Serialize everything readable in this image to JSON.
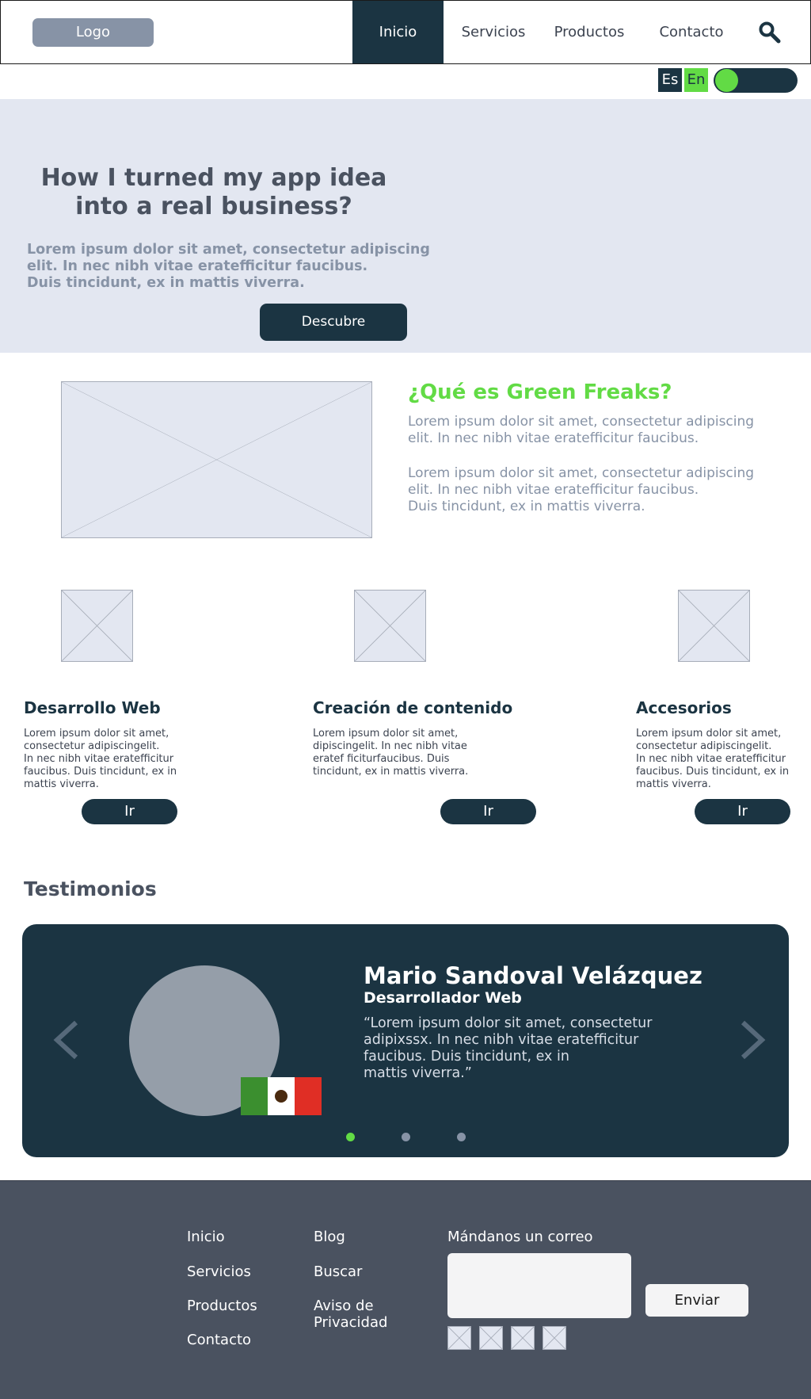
{
  "header": {
    "logo": "Logo",
    "nav": [
      "Inicio",
      "Servicios",
      "Productos",
      "Contacto"
    ],
    "active": "Inicio",
    "search_icon": "search-icon"
  },
  "language": {
    "es": "Es",
    "en": "En",
    "toggle_state": "on"
  },
  "hero": {
    "title": "How I turned my app idea into a real business?",
    "text_lines": [
      "Lorem ipsum dolor sit amet, consectetur adipiscing",
      "elit. In nec nibh vitae eratefficitur faucibus.",
      "Duis tincidunt, ex in mattis viverra."
    ],
    "button": "Descubre"
  },
  "about": {
    "title": "¿Qué es Green Freaks?",
    "para1_lines": [
      "Lorem ipsum dolor sit amet, consectetur adipiscing",
      "elit. In nec nibh vitae eratefficitur faucibus."
    ],
    "para2_lines": [
      "Lorem ipsum dolor sit amet, consectetur adipiscing",
      "elit. In nec nibh vitae eratefficitur faucibus.",
      "Duis tincidunt, ex in mattis viverra."
    ]
  },
  "services": [
    {
      "title": "Desarrollo Web",
      "lines": [
        "Lorem ipsum dolor sit amet,",
        "consectetur adipiscingelit.",
        "In nec nibh vitae eratefficitur",
        "faucibus. Duis tincidunt, ex in",
        "mattis viverra."
      ],
      "button": "Ir"
    },
    {
      "title": "Creación de contenido",
      "lines": [
        "Lorem ipsum dolor sit amet,",
        "dipiscingelit. In nec nibh vitae",
        "eratef ficiturfaucibus. Duis",
        "tincidunt, ex in mattis viverra."
      ],
      "button": "Ir"
    },
    {
      "title": "Accesorios",
      "lines": [
        "Lorem ipsum dolor sit amet,",
        "consectetur adipiscingelit.",
        "In nec nibh vitae eratefficitur",
        "faucibus. Duis tincidunt, ex in",
        "mattis viverra."
      ],
      "button": "Ir"
    }
  ],
  "testimonials": {
    "title": "Testimonios",
    "name": "Mario Sandoval Velázquez",
    "role": "Desarrollador Web",
    "quote_lines": [
      "“Lorem ipsum dolor sit amet, consectetur",
      "adipixssx. In nec nibh vitae eratefficitur",
      "faucibus. Duis tincidunt, ex in",
      "mattis viverra.”"
    ],
    "dots": 3,
    "active_dot": 0,
    "colors": {
      "card": "#1b3442",
      "accent": "#62db45"
    }
  },
  "footer": {
    "col1": [
      "Inicio",
      "Servicios",
      "Productos",
      "Contacto"
    ],
    "col2": [
      "Blog",
      "Buscar",
      "Aviso de Privacidad"
    ],
    "mail_label": "Mándanos un correo",
    "send_button": "Enviar",
    "social_icons": 4
  },
  "colors": {
    "primary": "#1b3442",
    "accent": "#62db45",
    "hero_bg": "#e3e7f1",
    "footer_bg": "#4a5260",
    "muted_text": "#8793a6"
  }
}
